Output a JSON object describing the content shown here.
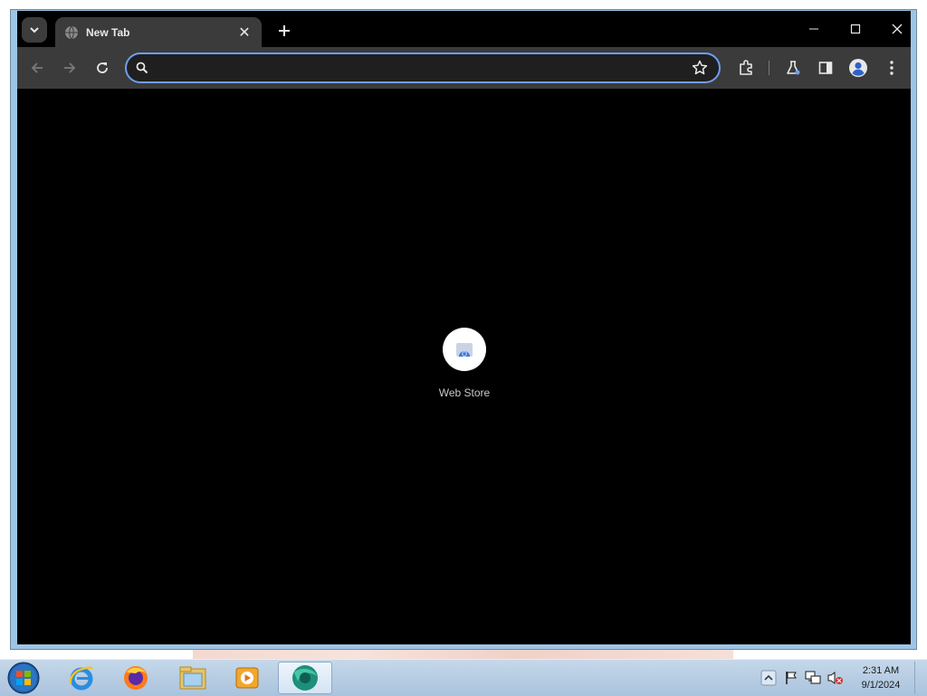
{
  "browser": {
    "tab": {
      "title": "New Tab",
      "favicon": "globe-icon"
    },
    "omnibox": {
      "value": "",
      "placeholder": ""
    },
    "toolbar_icons": [
      "back-icon",
      "forward-icon",
      "reload-icon",
      "search-icon",
      "star-icon",
      "extensions-icon",
      "labs-icon",
      "side-panel-icon",
      "profile-icon",
      "menu-icon"
    ],
    "window_controls": [
      "minimize-icon",
      "maximize-icon",
      "close-icon"
    ],
    "accent_color": "#6f9ef2"
  },
  "new_tab_page": {
    "shortcuts": [
      {
        "label": "Web Store",
        "icon": "web-store-icon"
      }
    ]
  },
  "taskbar": {
    "apps": [
      "start-orb-icon",
      "internet-explorer-icon",
      "firefox-icon",
      "file-explorer-icon",
      "media-player-icon",
      "chrome-app-icon"
    ],
    "tray_icons": [
      "show-hidden-icons-icon",
      "action-center-flag-icon",
      "network-icon",
      "volume-muted-icon"
    ],
    "clock": {
      "time": "2:31 AM",
      "date": "9/1/2024"
    }
  }
}
